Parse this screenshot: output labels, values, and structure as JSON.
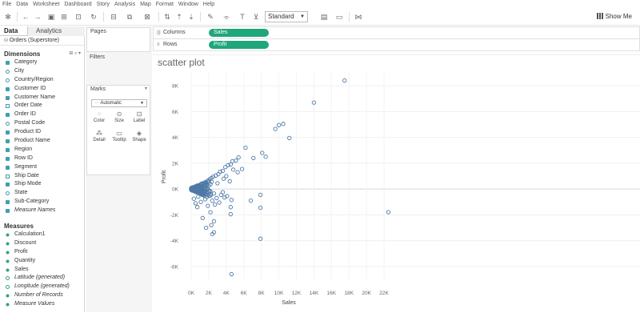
{
  "menu": [
    "File",
    "Data",
    "Worksheet",
    "Dashboard",
    "Story",
    "Analysis",
    "Map",
    "Format",
    "Window",
    "Help"
  ],
  "toolbar": {
    "standard_label": "Standard",
    "show_me_label": "Show Me"
  },
  "left_pane": {
    "tab_data": "Data",
    "tab_analytics": "Analytics",
    "datasource": "Orders (Superstore)",
    "dimensions_header": "Dimensions",
    "dimensions": [
      {
        "name": "Category",
        "icon": "dim"
      },
      {
        "name": "City",
        "icon": "geo"
      },
      {
        "name": "Country/Region",
        "icon": "geo"
      },
      {
        "name": "Customer ID",
        "icon": "dim"
      },
      {
        "name": "Customer Name",
        "icon": "dim"
      },
      {
        "name": "Order Date",
        "icon": "date"
      },
      {
        "name": "Order ID",
        "icon": "dim"
      },
      {
        "name": "Postal Code",
        "icon": "geo"
      },
      {
        "name": "Product ID",
        "icon": "dim"
      },
      {
        "name": "Product Name",
        "icon": "dim"
      },
      {
        "name": "Region",
        "icon": "dim"
      },
      {
        "name": "Row ID",
        "icon": "dim"
      },
      {
        "name": "Segment",
        "icon": "dim"
      },
      {
        "name": "Ship Date",
        "icon": "date"
      },
      {
        "name": "Ship Mode",
        "icon": "dim"
      },
      {
        "name": "State",
        "icon": "geo"
      },
      {
        "name": "Sub-Category",
        "icon": "dim"
      },
      {
        "name": "Measure Names",
        "icon": "dim",
        "italic": true
      }
    ],
    "measures_header": "Measures",
    "measures": [
      {
        "name": "Calculation1",
        "icon": "mea"
      },
      {
        "name": "Discount",
        "icon": "mea"
      },
      {
        "name": "Profit",
        "icon": "mea"
      },
      {
        "name": "Quantity",
        "icon": "mea"
      },
      {
        "name": "Sales",
        "icon": "mea"
      },
      {
        "name": "Latitude (generated)",
        "icon": "meag",
        "italic": true
      },
      {
        "name": "Longitude (generated)",
        "icon": "meag",
        "italic": true
      },
      {
        "name": "Number of Records",
        "icon": "mea",
        "italic": true
      },
      {
        "name": "Measure Values",
        "icon": "mea",
        "italic": true
      }
    ]
  },
  "cards": {
    "pages": "Pages",
    "filters": "Filters",
    "marks": "Marks",
    "mark_type": "Automatic",
    "mark_buttons": [
      "Color",
      "Size",
      "Label",
      "Detail",
      "Tooltip",
      "Shape"
    ]
  },
  "shelves": {
    "columns_label": "Columns",
    "columns_pill": "Sales",
    "rows_label": "Rows",
    "rows_pill": "Profit"
  },
  "sheet_title": "scatter plot",
  "colors": {
    "mark": "#4e79a7",
    "pill": "#1fa67a",
    "dimension": "#3d9fb0",
    "measure": "#37a37a"
  },
  "chart_data": {
    "type": "scatter",
    "title": "scatter plot",
    "xlabel": "Sales",
    "ylabel": "Profit",
    "xlim": [
      0,
      23000
    ],
    "ylim": [
      -7000,
      9000
    ],
    "x_ticks": [
      "0K",
      "2K",
      "4K",
      "6K",
      "8K",
      "10K",
      "12K",
      "14K",
      "16K",
      "18K",
      "20K",
      "22K"
    ],
    "y_ticks": [
      "-6K",
      "-4K",
      "-2K",
      "0K",
      "2K",
      "4K",
      "6K",
      "8K"
    ],
    "grid": true,
    "points": [
      [
        17500,
        8400
      ],
      [
        14000,
        6700
      ],
      [
        10500,
        5050
      ],
      [
        10000,
        4950
      ],
      [
        9600,
        4650
      ],
      [
        11200,
        3950
      ],
      [
        6200,
        3200
      ],
      [
        8100,
        2800
      ],
      [
        8500,
        2500
      ],
      [
        7100,
        2400
      ],
      [
        5400,
        2450
      ],
      [
        5100,
        2200
      ],
      [
        4700,
        2150
      ],
      [
        4500,
        1900
      ],
      [
        4200,
        1850
      ],
      [
        3900,
        1700
      ],
      [
        5800,
        1550
      ],
      [
        4800,
        1500
      ],
      [
        3600,
        1400
      ],
      [
        3300,
        1350
      ],
      [
        5300,
        1300
      ],
      [
        3100,
        1150
      ],
      [
        2800,
        1050
      ],
      [
        4000,
        1000
      ],
      [
        2500,
        950
      ],
      [
        2300,
        850
      ],
      [
        3700,
        800
      ],
      [
        2100,
        750
      ],
      [
        1900,
        650
      ],
      [
        4400,
        600
      ],
      [
        1700,
        550
      ],
      [
        1500,
        500
      ],
      [
        3000,
        450
      ],
      [
        1300,
        400
      ],
      [
        1100,
        350
      ],
      [
        900,
        300
      ],
      [
        2000,
        250
      ],
      [
        700,
        200
      ],
      [
        500,
        150
      ],
      [
        1600,
        120
      ],
      [
        300,
        80
      ],
      [
        200,
        40
      ],
      [
        100,
        20
      ],
      [
        400,
        -50
      ],
      [
        800,
        -100
      ],
      [
        1200,
        -150
      ],
      [
        600,
        -200
      ],
      [
        1800,
        -250
      ],
      [
        1000,
        -300
      ],
      [
        2600,
        -350
      ],
      [
        1400,
        -400
      ],
      [
        3400,
        -450
      ],
      [
        2200,
        -500
      ],
      [
        4100,
        -550
      ],
      [
        800,
        -600
      ],
      [
        3800,
        -650
      ],
      [
        2900,
        -700
      ],
      [
        7900,
        -450
      ],
      [
        300,
        -750
      ],
      [
        1600,
        -800
      ],
      [
        4600,
        -850
      ],
      [
        2400,
        -900
      ],
      [
        1100,
        -1000
      ],
      [
        3200,
        -1050
      ],
      [
        500,
        -1100
      ],
      [
        7900,
        -1450
      ],
      [
        4500,
        -1400
      ],
      [
        2700,
        -1200
      ],
      [
        1900,
        -1300
      ],
      [
        700,
        -1400
      ],
      [
        4500,
        -1950
      ],
      [
        2200,
        -1800
      ],
      [
        1300,
        -2250
      ],
      [
        2600,
        -2500
      ],
      [
        2300,
        -2800
      ],
      [
        1700,
        -3000
      ],
      [
        2400,
        -3500
      ],
      [
        2600,
        -3350
      ],
      [
        22500,
        -1800
      ],
      [
        7900,
        -3850
      ],
      [
        4600,
        -6600
      ],
      [
        6800,
        -900
      ],
      [
        3600,
        -250
      ]
    ]
  }
}
